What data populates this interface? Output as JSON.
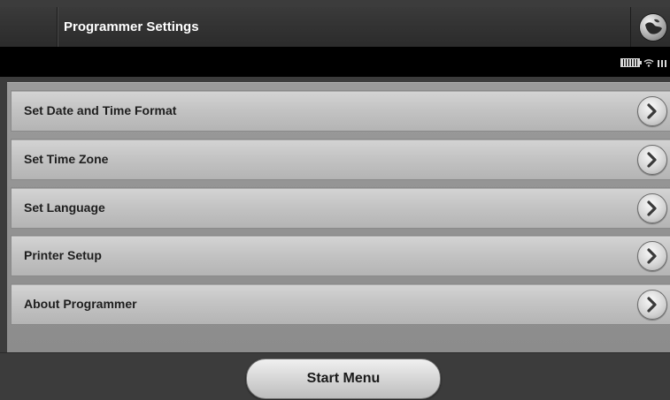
{
  "header": {
    "title": "Programmer Settings",
    "logo_icon": "globe-logo-icon"
  },
  "status_bar": {
    "icons": [
      "battery-icon",
      "wifi-icon",
      "signal-icon"
    ]
  },
  "menu": {
    "items": [
      {
        "label": "Set Date and Time Format",
        "icon": "chevron-right-icon"
      },
      {
        "label": "Set Time Zone",
        "icon": "chevron-right-icon"
      },
      {
        "label": "Set Language",
        "icon": "chevron-right-icon"
      },
      {
        "label": "Printer Setup",
        "icon": "chevron-right-icon"
      },
      {
        "label": "About Programmer",
        "icon": "chevron-right-icon"
      }
    ]
  },
  "footer": {
    "start_menu_label": "Start Menu"
  },
  "colors": {
    "header_bg": "#2b2b2b",
    "status_bar_bg": "#000000",
    "panel_bg": "#8c8c8c",
    "row_bg": "#c4c4c4",
    "text_dark": "#1e1e1e",
    "text_light": "#ffffff"
  }
}
